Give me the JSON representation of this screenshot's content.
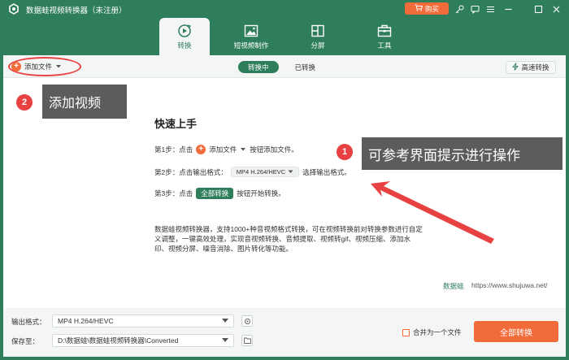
{
  "app": {
    "title": "数据蛙视频转换器（未注册）",
    "buy_label": "购买"
  },
  "nav": {
    "tabs": [
      {
        "label": "转换",
        "icon": "convert-icon",
        "active": true
      },
      {
        "label": "短视频制作",
        "icon": "image-icon",
        "active": false
      },
      {
        "label": "分屏",
        "icon": "split-screen-icon",
        "active": false
      },
      {
        "label": "工具",
        "icon": "toolbox-icon",
        "active": false
      }
    ]
  },
  "toolbar": {
    "add_file_label": "添加文件",
    "segments": [
      {
        "label": "转换中",
        "active": true
      },
      {
        "label": "已转换",
        "active": false
      }
    ],
    "fast_convert_label": "高速转换"
  },
  "callouts": {
    "add_video": {
      "number": "2",
      "text": "添加视频"
    },
    "hint": {
      "number": "1",
      "text": "可参考界面提示进行操作"
    }
  },
  "guide": {
    "title": "快速上手",
    "step1": {
      "prefix": "第1步：点击",
      "button": "添加文件",
      "suffix": "按钮添加文件。"
    },
    "step2": {
      "prefix": "第2步：点击输出格式：",
      "format": "MP4 H.264/HEVC",
      "suffix": "选择输出格式。"
    },
    "step3": {
      "prefix": "第3步：点击",
      "button": "全部转换",
      "suffix": "按钮开始转换。"
    },
    "description": "数据蛙视频转换器，支持1000+种音视频格式转换，可在视频转换前对转换参数进行自定义调整，一键高效处理，实现音视频转换、音频提取、视频转gif、视频压缩、添加水印、视频分屏、噪音消除、图片转化等功能。",
    "brand": "数据蛙",
    "url": "https://www.shujuwa.net/"
  },
  "bottom": {
    "output_format_label": "输出格式：",
    "output_format_value": "MP4 H.264/HEVC",
    "save_to_label": "保存至：",
    "save_to_value": "D:\\数据蛙\\数据蛙视频转换器\\Converted",
    "merge_label": "合并为一个文件",
    "merge_checked": false,
    "convert_all_label": "全部转换"
  },
  "colors": {
    "brand_green": "#2e7d5b",
    "accent_orange": "#f26b3a",
    "callout_red": "#e84141"
  }
}
